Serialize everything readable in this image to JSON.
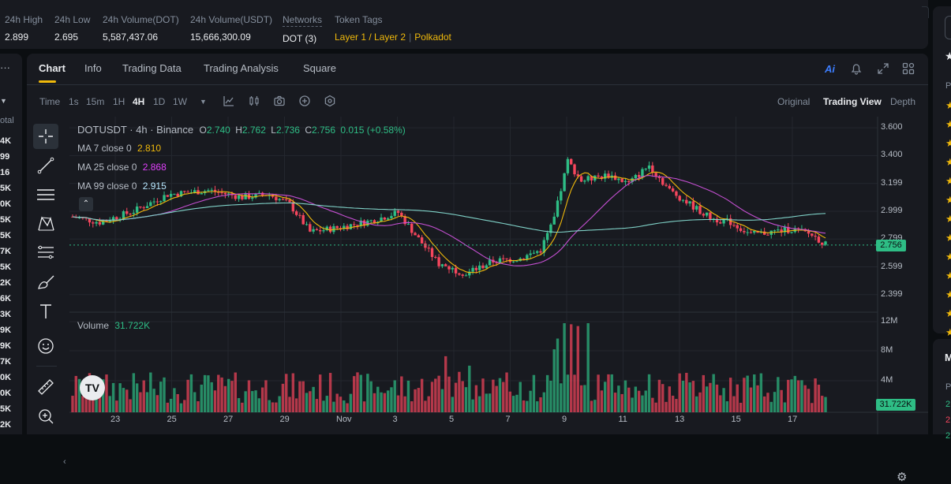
{
  "stats": [
    {
      "label": "24h High",
      "value": "2.899"
    },
    {
      "label": "24h Low",
      "value": "2.695"
    },
    {
      "label": "24h Volume(DOT)",
      "value": "5,587,437.06"
    },
    {
      "label": "24h Volume(USDT)",
      "value": "15,666,300.09"
    },
    {
      "label": "Networks",
      "value": "DOT (3)"
    },
    {
      "label": "Token Tags",
      "value": ""
    }
  ],
  "token_tags": [
    "Layer 1 / Layer 2",
    "Polkadot"
  ],
  "left_strip": {
    "top_symbol": "...",
    "label": "otal",
    "values": [
      "4K",
      "99",
      "16",
      "5K",
      "0K",
      "5K",
      "5K",
      "7K",
      "5K",
      "2K",
      "6K",
      "3K",
      "9K",
      "9K",
      "7K",
      "0K",
      "0K",
      "5K",
      "2K"
    ]
  },
  "tabs": [
    "Chart",
    "Info",
    "Trading Data",
    "Trading Analysis",
    "Square"
  ],
  "intervals": [
    "Time",
    "1s",
    "15m",
    "1H",
    "4H",
    "1D",
    "1W"
  ],
  "active_interval": "4H",
  "views": [
    "Original",
    "Trading View",
    "Depth"
  ],
  "active_view": "Trading View",
  "header_icons": [
    "ai-icon",
    "bell-icon",
    "expand-icon",
    "grid-icon"
  ],
  "ohlc": {
    "pair": "DOTUSDT · 4h · Binance",
    "o_label": "O",
    "o": "2.740",
    "h_label": "H",
    "h": "2.762",
    "l_label": "L",
    "l": "2.736",
    "c_label": "C",
    "c": "2.756",
    "change": "0.015 (+0.58%)"
  },
  "ma": [
    {
      "label": "MA 7 close 0",
      "value": "2.810",
      "color": "#f0b90b"
    },
    {
      "label": "MA 25 close 0",
      "value": "2.868",
      "color": "#e040fb"
    },
    {
      "label": "MA 99 close 0",
      "value": "2.915",
      "color": "#b8e8ff"
    }
  ],
  "volume": {
    "label": "Volume",
    "value": "31.722K"
  },
  "colors": {
    "up": "#2ebd85",
    "down": "#f6465d",
    "ma7": "#f0b90b",
    "ma25": "#c34fd0",
    "ma99": "#7fd1c7",
    "accent": "#f0b90b"
  },
  "chart_data": {
    "type": "candlestick",
    "y_ticks": [
      "3.600",
      "3.400",
      "3.199",
      "2.999",
      "2.799",
      "2.599",
      "2.399"
    ],
    "current_price": "2.756",
    "volume_ticks": [
      "12M",
      "8M",
      "4M"
    ],
    "volume_current": "31.722K",
    "x_ticks": [
      "23",
      "25",
      "27",
      "29",
      "Nov",
      "3",
      "5",
      "7",
      "9",
      "11",
      "13",
      "15",
      "17"
    ],
    "ylim": [
      2.3,
      3.65
    ]
  }
}
